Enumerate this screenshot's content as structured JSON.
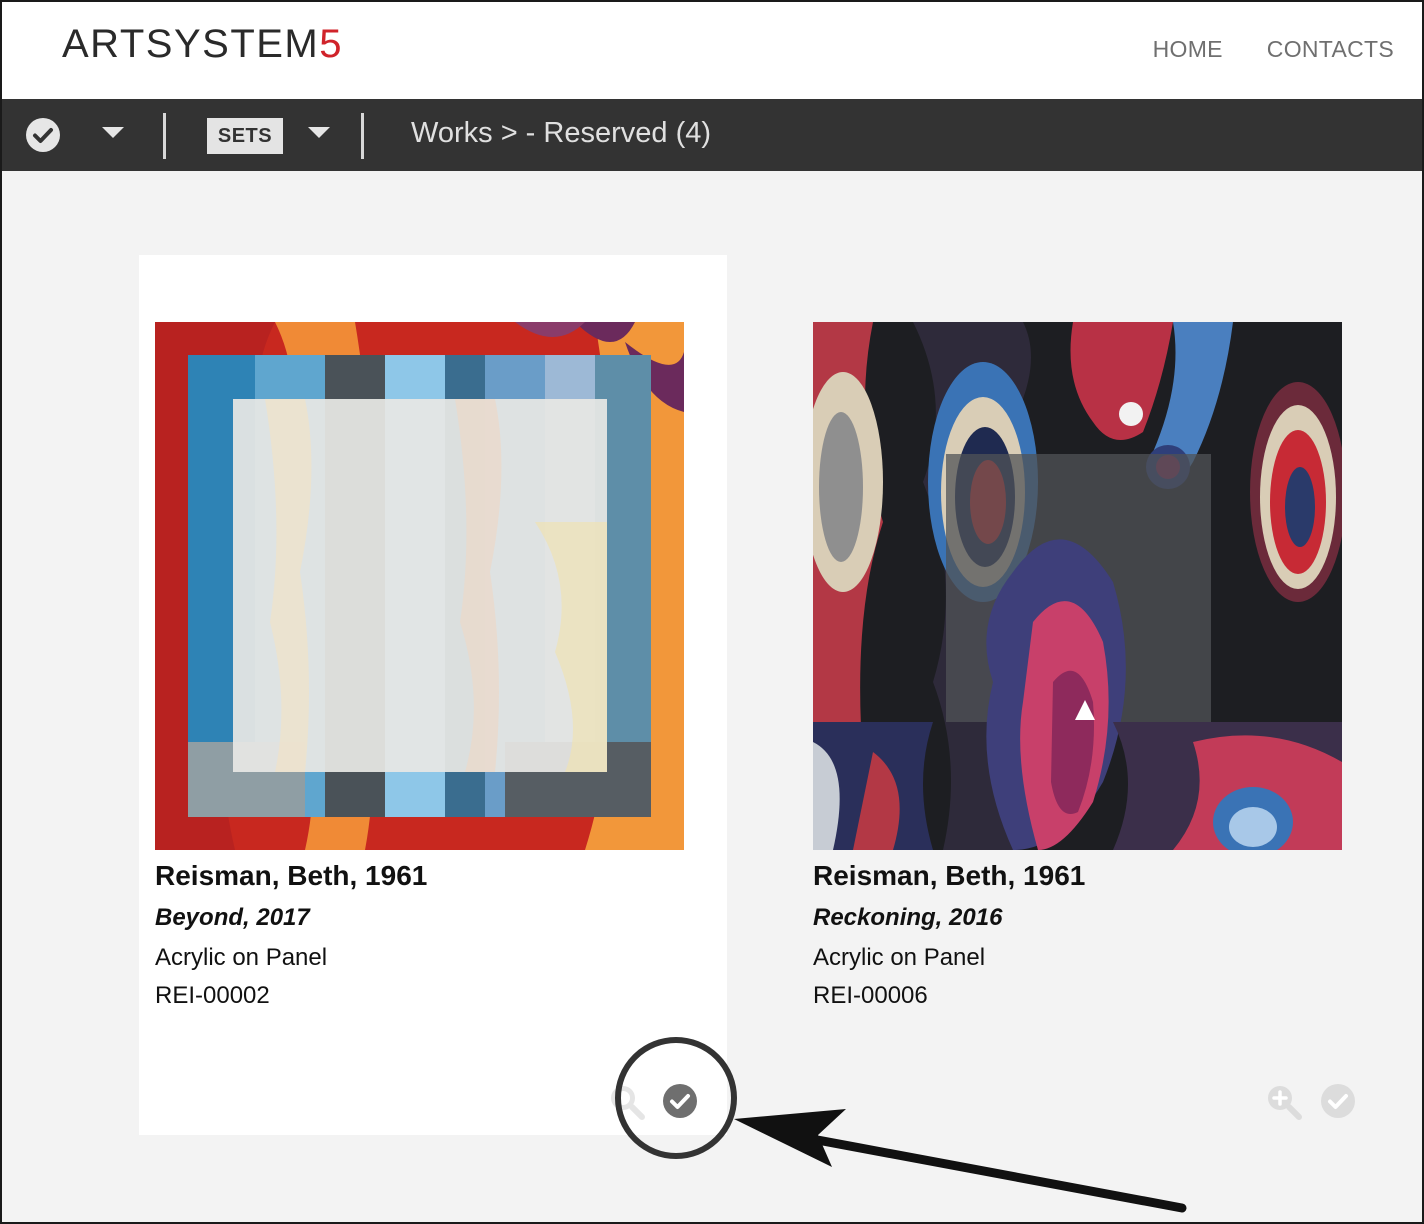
{
  "header": {
    "logo_main": "ARTSYSTEM",
    "logo_accent": "5",
    "nav": [
      "HOME",
      "CONTACTS"
    ]
  },
  "toolbar": {
    "sets_label": "SETS",
    "breadcrumb": "Works > - Reserved (4)"
  },
  "works": [
    {
      "artist": "Reisman, Beth, 1961",
      "title": "Beyond, 2017",
      "medium": "Acrylic on Panel",
      "code": "REI-00002",
      "selected": true
    },
    {
      "artist": "Reisman, Beth, 1961",
      "title": "Reckoning, 2016",
      "medium": "Acrylic on Panel",
      "code": "REI-00006",
      "selected": false
    }
  ],
  "colors": {
    "toolbar_bg": "#333333",
    "accent": "#d0232a",
    "page_bg": "#f3f3f3"
  }
}
